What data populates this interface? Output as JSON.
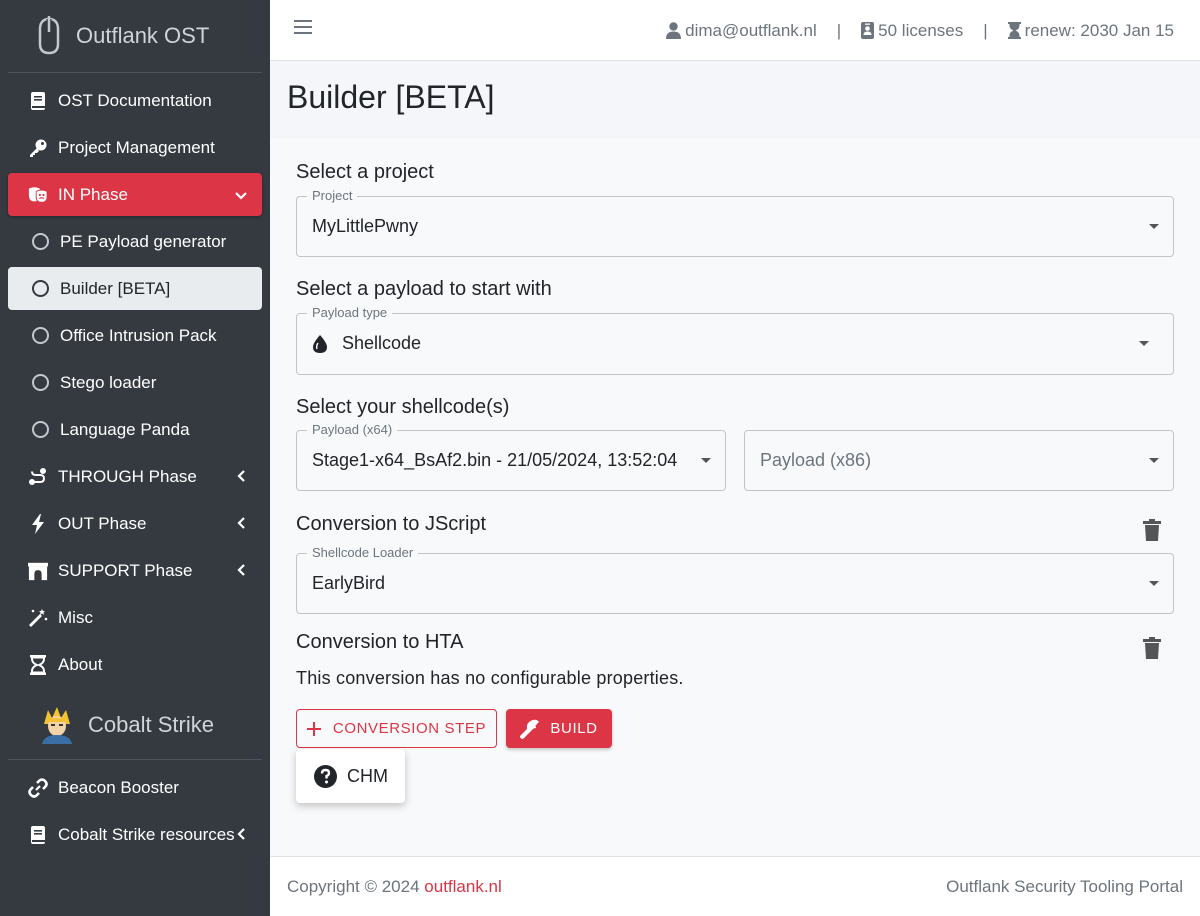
{
  "brand": {
    "name": "Outflank OST"
  },
  "sidebar": {
    "items": [
      {
        "label": "OST Documentation",
        "icon": "book-icon"
      },
      {
        "label": "Project Management",
        "icon": "key-icon"
      },
      {
        "label": "IN Phase",
        "icon": "mask-icon",
        "expanded": true
      },
      {
        "label": "PE Payload generator",
        "icon": "circle-icon"
      },
      {
        "label": "Builder [BETA]",
        "icon": "circle-icon",
        "active": true
      },
      {
        "label": "Office Intrusion Pack",
        "icon": "circle-icon"
      },
      {
        "label": "Stego loader",
        "icon": "circle-icon"
      },
      {
        "label": "Language Panda",
        "icon": "circle-icon"
      },
      {
        "label": "THROUGH Phase",
        "icon": "route-icon"
      },
      {
        "label": "OUT Phase",
        "icon": "bolt-icon"
      },
      {
        "label": "SUPPORT Phase",
        "icon": "archway-icon"
      },
      {
        "label": "Misc",
        "icon": "magic-wand-icon"
      },
      {
        "label": "About",
        "icon": "hourglass-icon"
      }
    ],
    "cs_header": "Cobalt Strike",
    "cs_items": [
      {
        "label": "Beacon Booster",
        "icon": "link-icon"
      },
      {
        "label": "Cobalt Strike resources",
        "icon": "book-icon"
      }
    ]
  },
  "topbar": {
    "user": "dima@outflank.nl",
    "licenses": "50 licenses",
    "renew": "renew: 2030 Jan 15",
    "separator": "|"
  },
  "page": {
    "title": "Builder [BETA]"
  },
  "form": {
    "project_section": "Select a project",
    "project_label": "Project",
    "project_value": "MyLittlePwny",
    "payload_section": "Select a payload to start with",
    "payload_type_label": "Payload type",
    "payload_type_value": "Shellcode",
    "shellcode_section": "Select your shellcode(s)",
    "x64_label": "Payload (x64)",
    "x64_value": "Stage1-x64_BsAf2.bin - 21/05/2024, 13:52:04",
    "x86_placeholder": "Payload (x86)",
    "jscript_section": "Conversion to JScript",
    "loader_label": "Shellcode Loader",
    "loader_value": "EarlyBird",
    "hta_section": "Conversion to HTA",
    "hta_text": "This conversion has no configurable properties.",
    "add_step_label": "CONVERSION STEP",
    "build_label": "BUILD",
    "menu_item": "CHM"
  },
  "footer": {
    "copyright": "Copyright © 2024 ",
    "link": "outflank.nl",
    "right": "Outflank Security Tooling Portal"
  },
  "colors": {
    "accent": "#dc3545",
    "sidebar_bg": "#343a40"
  }
}
